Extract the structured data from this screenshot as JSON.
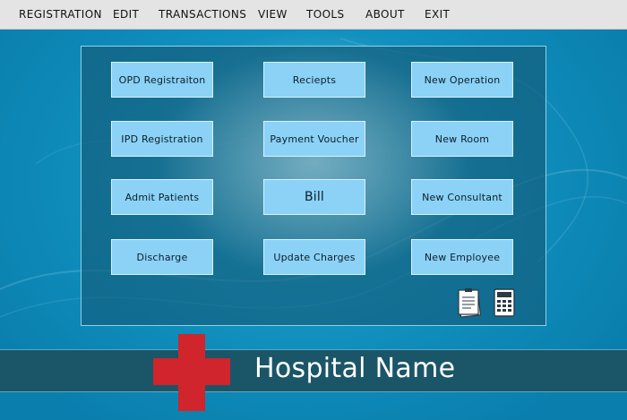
{
  "menu": {
    "items": [
      {
        "label": "REGISTRATION"
      },
      {
        "label": "EDIT"
      },
      {
        "label": "TRANSACTIONS"
      },
      {
        "label": "VIEW"
      },
      {
        "label": "TOOLS"
      },
      {
        "label": "ABOUT"
      },
      {
        "label": "EXIT"
      }
    ]
  },
  "buttons": {
    "opd_registration": "OPD Registraiton",
    "receipts": "Reciepts",
    "new_operation": "New Operation",
    "ipd_registration": "IPD Registration",
    "payment_voucher": "Payment Voucher",
    "new_room": "New Room",
    "admit_patients": "Admit Patients",
    "bill": "Bill",
    "new_consultant": "New Consultant",
    "discharge": "Discharge",
    "update_charges": "Update Charges",
    "new_employee": "New Employee"
  },
  "tools": {
    "notepad_icon": "notepad-icon",
    "calculator_icon": "calculator-icon"
  },
  "footer": {
    "hospital_name": "Hospital Name",
    "logo_icon": "red-cross-icon"
  },
  "colors": {
    "menubar": "#e4e4e4",
    "desktop": "#0d8fb8",
    "button": "#8bd2f6",
    "band": "#1b5568",
    "cross": "#d0252c"
  }
}
